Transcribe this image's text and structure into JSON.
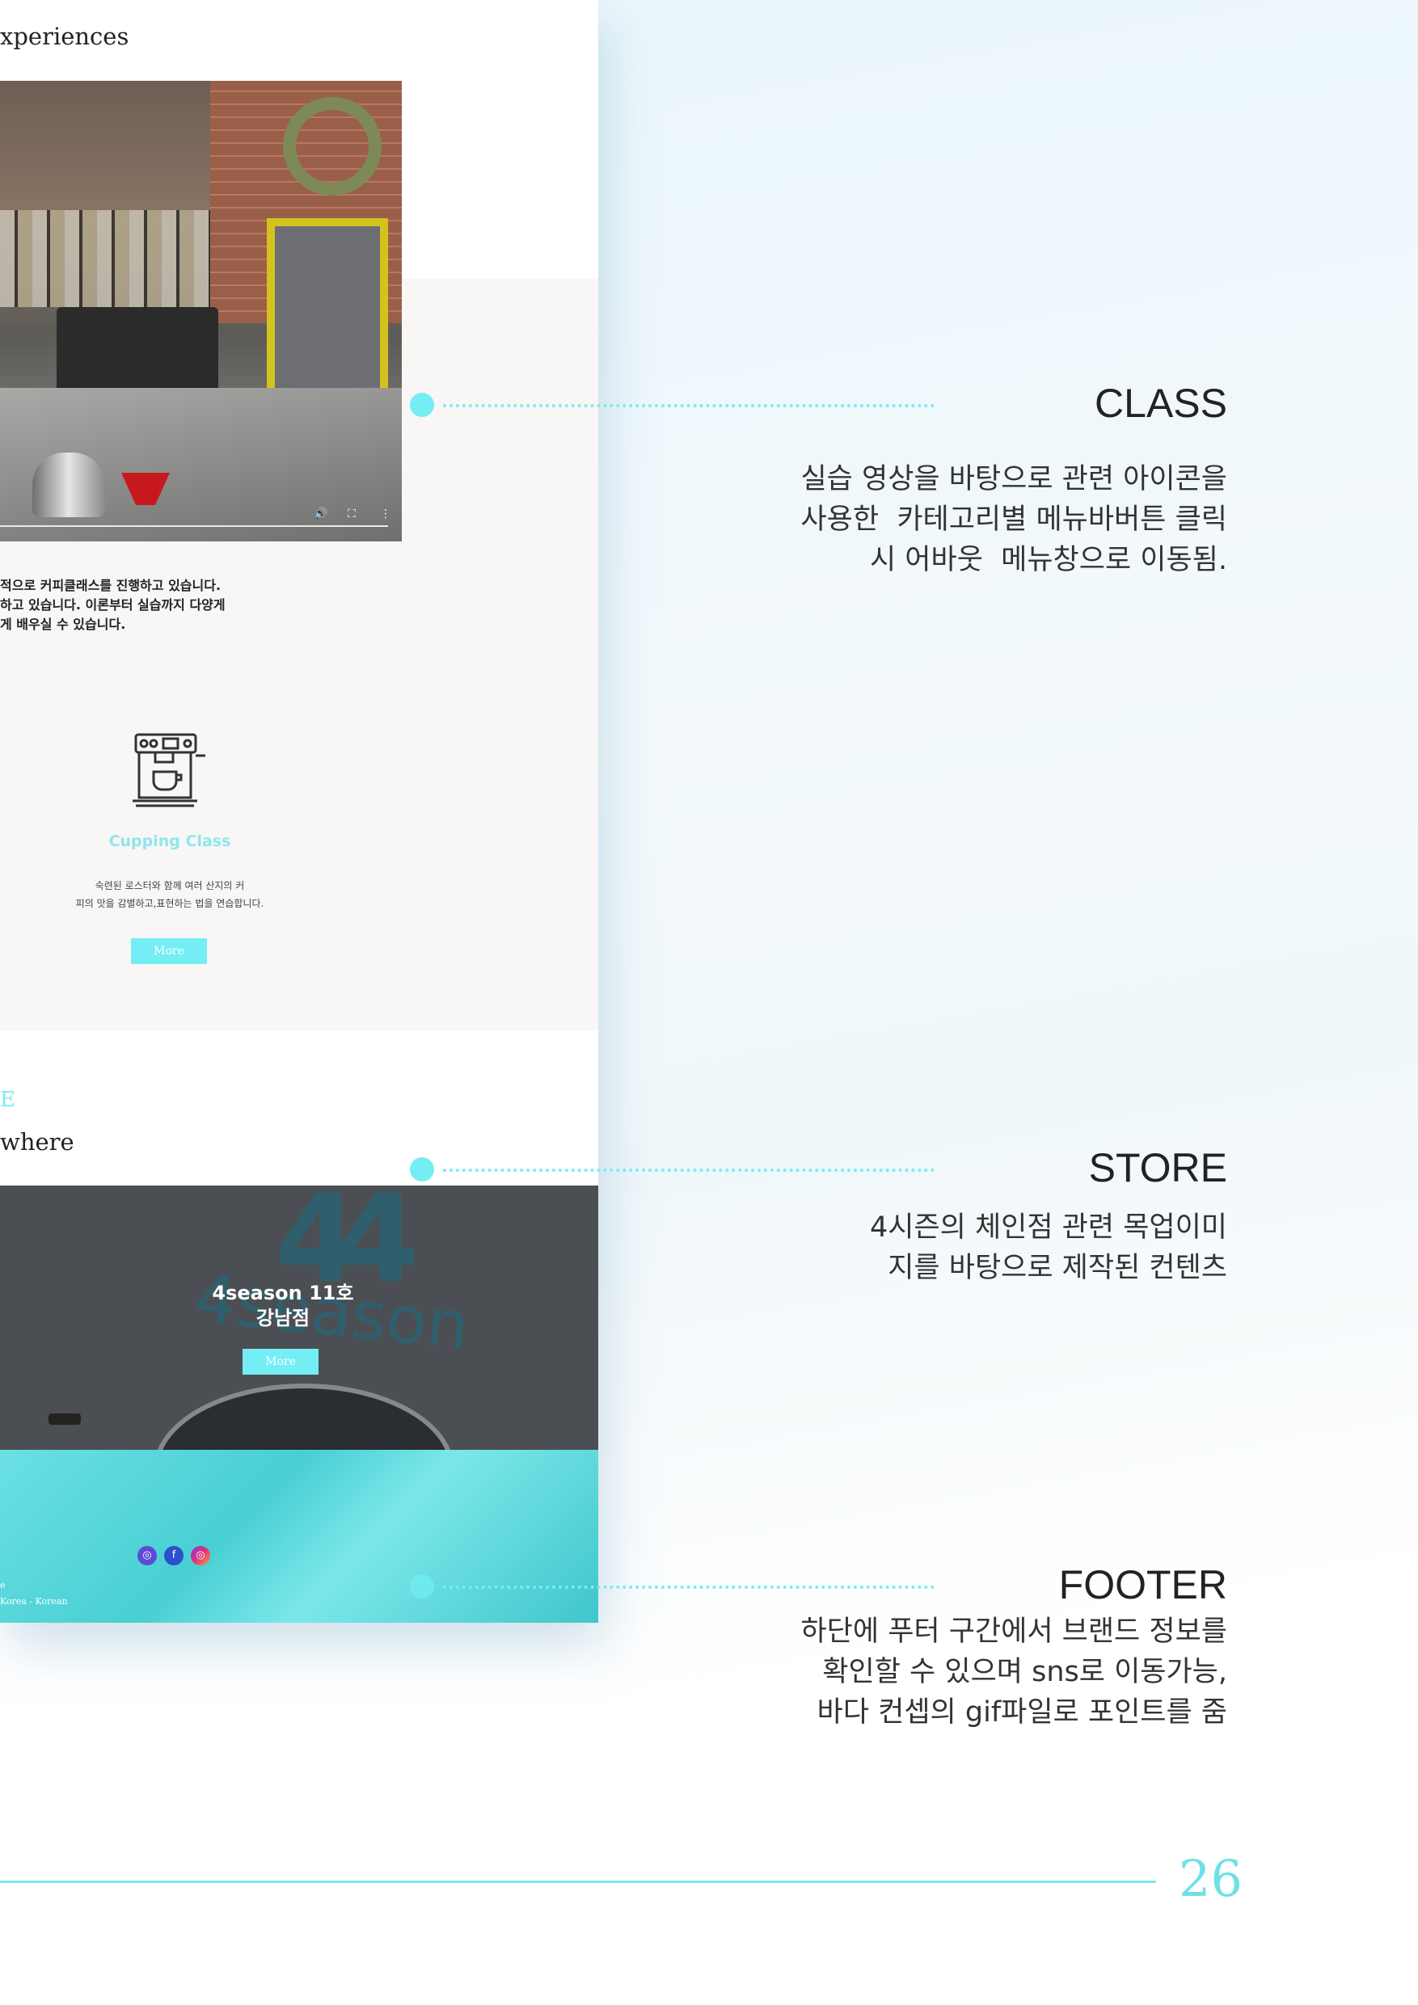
{
  "mockup": {
    "experience_title": "xperiences",
    "video_controls": {
      "volume": "🔊",
      "fullscreen": "⛶",
      "more": "⋮"
    },
    "class_desc": "적으로 커피클래스를 진행하고 있습니다.\n하고 있습니다. 이론부터 실습까지 다양게\n게 배우실 수 있습니다.",
    "cupping_title": "Cupping Class",
    "cupping_text": "숙련된 로스터와 함께 여러 산지의 커\n피의 맛을 감별하고,표현하는 법을 연습합니다.",
    "more_label": "More",
    "store_kicker": "E",
    "store_title": "where",
    "store_name": "4season 11호\n강남점",
    "store_logo_num": "44",
    "store_logo_text": "4season",
    "sns_icons": [
      "instagram-glyph-icon",
      "facebook-icon",
      "instagram-icon"
    ],
    "sns_glyphs": [
      "◎",
      "f",
      "◎"
    ],
    "footer_small_1": "e",
    "footer_small_2": "Korea - Korean"
  },
  "annotations": [
    {
      "title": "CLASS",
      "body": "실습 영상을 바탕으로 관련 아이콘을\n사용한  카테고리별 메뉴바버튼 클릭\n시 어바웃  메뉴창으로 이동됨."
    },
    {
      "title": "STORE",
      "body": "4시즌의 체인점 관련 목업이미\n지를 바탕으로 제작된 컨텐츠"
    },
    {
      "title": "FOOTER",
      "body": "하단에 푸터 구간에서 브랜드 정보를\n확인할 수 있으며 sns로 이동가능,\n바다 컨셉의 gif파일로 포인트를 줌"
    }
  ],
  "page_number": "26",
  "colors": {
    "accent": "#74eef4",
    "page_line": "#7ee6ea",
    "text": "#222222"
  }
}
